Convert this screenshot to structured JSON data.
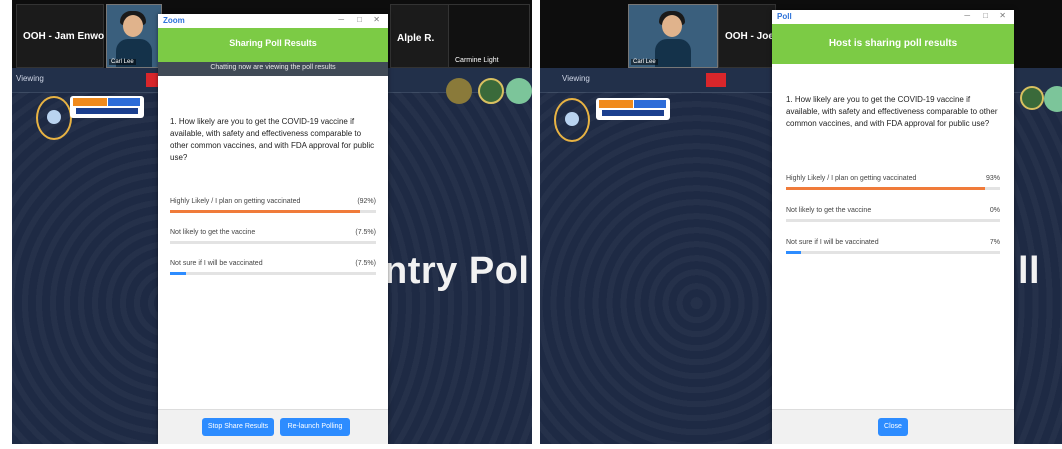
{
  "left": {
    "meeting_tiles": {
      "host_label": "OOH - Jam Enwo",
      "video_name": "Carl Lee",
      "right_tile_label": "Alple R.",
      "right_tile_sub": "Carmine Light"
    },
    "zoom_bar": {
      "status_text": "Viewing",
      "center_text": "Chatting now are viewing the poll results"
    },
    "poll": {
      "app_name": "Zoom",
      "header": "Sharing Poll Results",
      "question": "1. How likely are you to get the COVID-19 vaccine if available, with safety and effectiveness comparable to other common vaccines, and with FDA approval for public use?",
      "options": [
        {
          "label": "Highly Likely / I plan on getting vaccinated",
          "value": "(92%)",
          "percent": 92,
          "color": "#f07b3a"
        },
        {
          "label": "Not likely to get the vaccine",
          "value": "(7.5%)",
          "percent": 0,
          "color": "#2d8cff"
        },
        {
          "label": "Not sure if I will be vaccinated",
          "value": "(7.5%)",
          "percent": 8,
          "color": "#2d8cff"
        }
      ],
      "buttons": {
        "share": "Stop Share Results",
        "relaunch": "Re-launch Polling"
      }
    },
    "background_text": "ntry Poll"
  },
  "right": {
    "meeting_tiles": {
      "video_name": "Carl Lee",
      "host_label": "OOH - Joe"
    },
    "zoom_bar": {
      "status_text": "Viewing",
      "center_text": "Chatting now are viewing the poll results"
    },
    "poll": {
      "app_name": "Poll",
      "header": "Host is sharing poll results",
      "question": "1. How likely are you to get the COVID-19 vaccine if available, with safety and effectiveness comparable to other common vaccines, and with FDA approval for public use?",
      "options": [
        {
          "label": "Highly Likely / I plan on getting vaccinated",
          "value": "93%",
          "percent": 93,
          "color": "#f07b3a"
        },
        {
          "label": "Not likely to get the vaccine",
          "value": "0%",
          "percent": 0,
          "color": "#2d8cff"
        },
        {
          "label": "Not sure if I will be vaccinated",
          "value": "7%",
          "percent": 7,
          "color": "#2d8cff"
        }
      ],
      "buttons": {
        "close": "Close"
      }
    },
    "background_text": "ll"
  }
}
